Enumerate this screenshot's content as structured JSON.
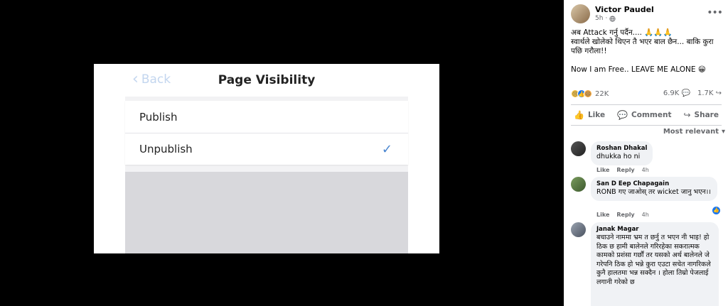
{
  "screenshot": {
    "back_label": "Back",
    "title": "Page Visibility",
    "options": [
      {
        "label": "Publish",
        "selected": false
      },
      {
        "label": "Unpublish",
        "selected": true
      }
    ]
  },
  "post": {
    "author": "Victor Paudel",
    "time": "5h",
    "privacy_icon": "globe-icon",
    "text_line1": "अब Attack गर्नु पर्दैन.... 🙏🙏🙏",
    "text_line2": "स्वार्थले खोलेको थिएन तै भएर बाल छैन... बाकि कुरा पछि गरौला!!",
    "text_line3": "Now I am Free.. LEAVE ME ALONE 😀",
    "reaction_count": "22K",
    "comments_count": "6.9K",
    "shares_count": "1.7K",
    "actions": {
      "like": "Like",
      "comment": "Comment",
      "share": "Share"
    },
    "sort_label": "Most relevant"
  },
  "comments": [
    {
      "name": "Roshan Dhakal",
      "text": "dhukka ho ni",
      "like": "Like",
      "reply": "Reply",
      "time": "4h"
    },
    {
      "name": "San D Eep Chapagain",
      "text": "RONB गए जाओस् तर wicket जानु भएन।।",
      "like": "Like",
      "reply": "Reply",
      "time": "4h"
    },
    {
      "name": "Janak Magar",
      "text": "बचाउने नाममा भ्रम त छर्नु त भएन नी भाइ! हो ठिक छ हामी बालेनले गरिरहेका सकरात्मक कामको प्रशंसा गर्छौं तर यसको अर्थ बालेनले जे गरेपनि ठिक हो भन्ने कुरा एउटा सचेत नागरिकले कुनै हालतमा भन्न सक्दैन । होला तिम्रो पेजलाई लगानी गरेको छ"
    }
  ],
  "colors": {
    "accent": "#1877f2",
    "check": "#4a86d0",
    "muted": "#65676b"
  }
}
